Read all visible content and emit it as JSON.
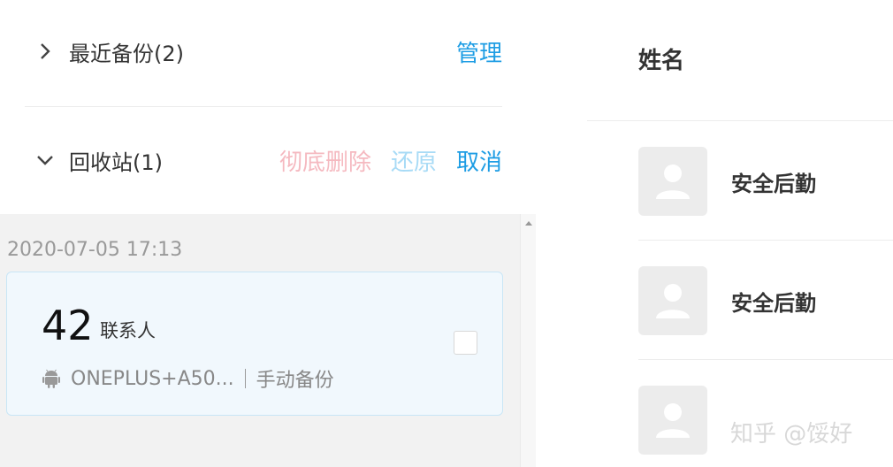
{
  "backup_section": {
    "title": "最近备份(2)",
    "manage_label": "管理"
  },
  "recycle_section": {
    "title": "回收站(1)",
    "delete_label": "彻底删除",
    "restore_label": "还原",
    "cancel_label": "取消"
  },
  "recycle_item": {
    "date": "2020-07-05 17:13",
    "count": "42",
    "count_label": "联系人",
    "device": "ONEPLUS+A50...",
    "backup_type": "手动备份",
    "checked": false
  },
  "contacts_panel": {
    "header": "姓名",
    "contacts": [
      {
        "name": "安全后勤"
      },
      {
        "name": "安全后勤"
      },
      {
        "name": ""
      }
    ]
  },
  "watermark": "知乎 @馁好",
  "colors": {
    "accent": "#1e9de4",
    "danger_disabled": "#f5b9c0",
    "accent_disabled": "#a8dbf6",
    "card_bg": "#f1f8fd"
  },
  "icons": {
    "backup_toggle": "chevron-right-icon",
    "recycle_toggle": "chevron-down-icon",
    "device": "android-icon",
    "avatar": "person-icon"
  }
}
